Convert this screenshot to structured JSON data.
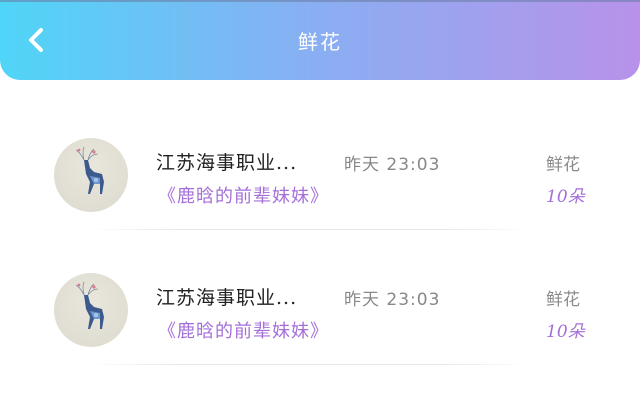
{
  "header": {
    "title": "鲜花",
    "back_icon": "chevron-left-icon",
    "gradient": [
      "#4fd5f7",
      "#b892ea"
    ]
  },
  "gifts": [
    {
      "sender": "江苏海事职业...",
      "time": "昨天  23:03",
      "book": "《鹿晗的前辈妹妹》",
      "gift_type": "鲜花",
      "count": "10朵",
      "avatar_icon": "deer-avatar-icon"
    },
    {
      "sender": "江苏海事职业...",
      "time": "昨天  23:03",
      "book": "《鹿晗的前辈妹妹》",
      "gift_type": "鲜花",
      "count": "10朵",
      "avatar_icon": "deer-avatar-icon"
    }
  ],
  "colors": {
    "accent": "#a46fd9",
    "muted": "#8b8b8b"
  }
}
